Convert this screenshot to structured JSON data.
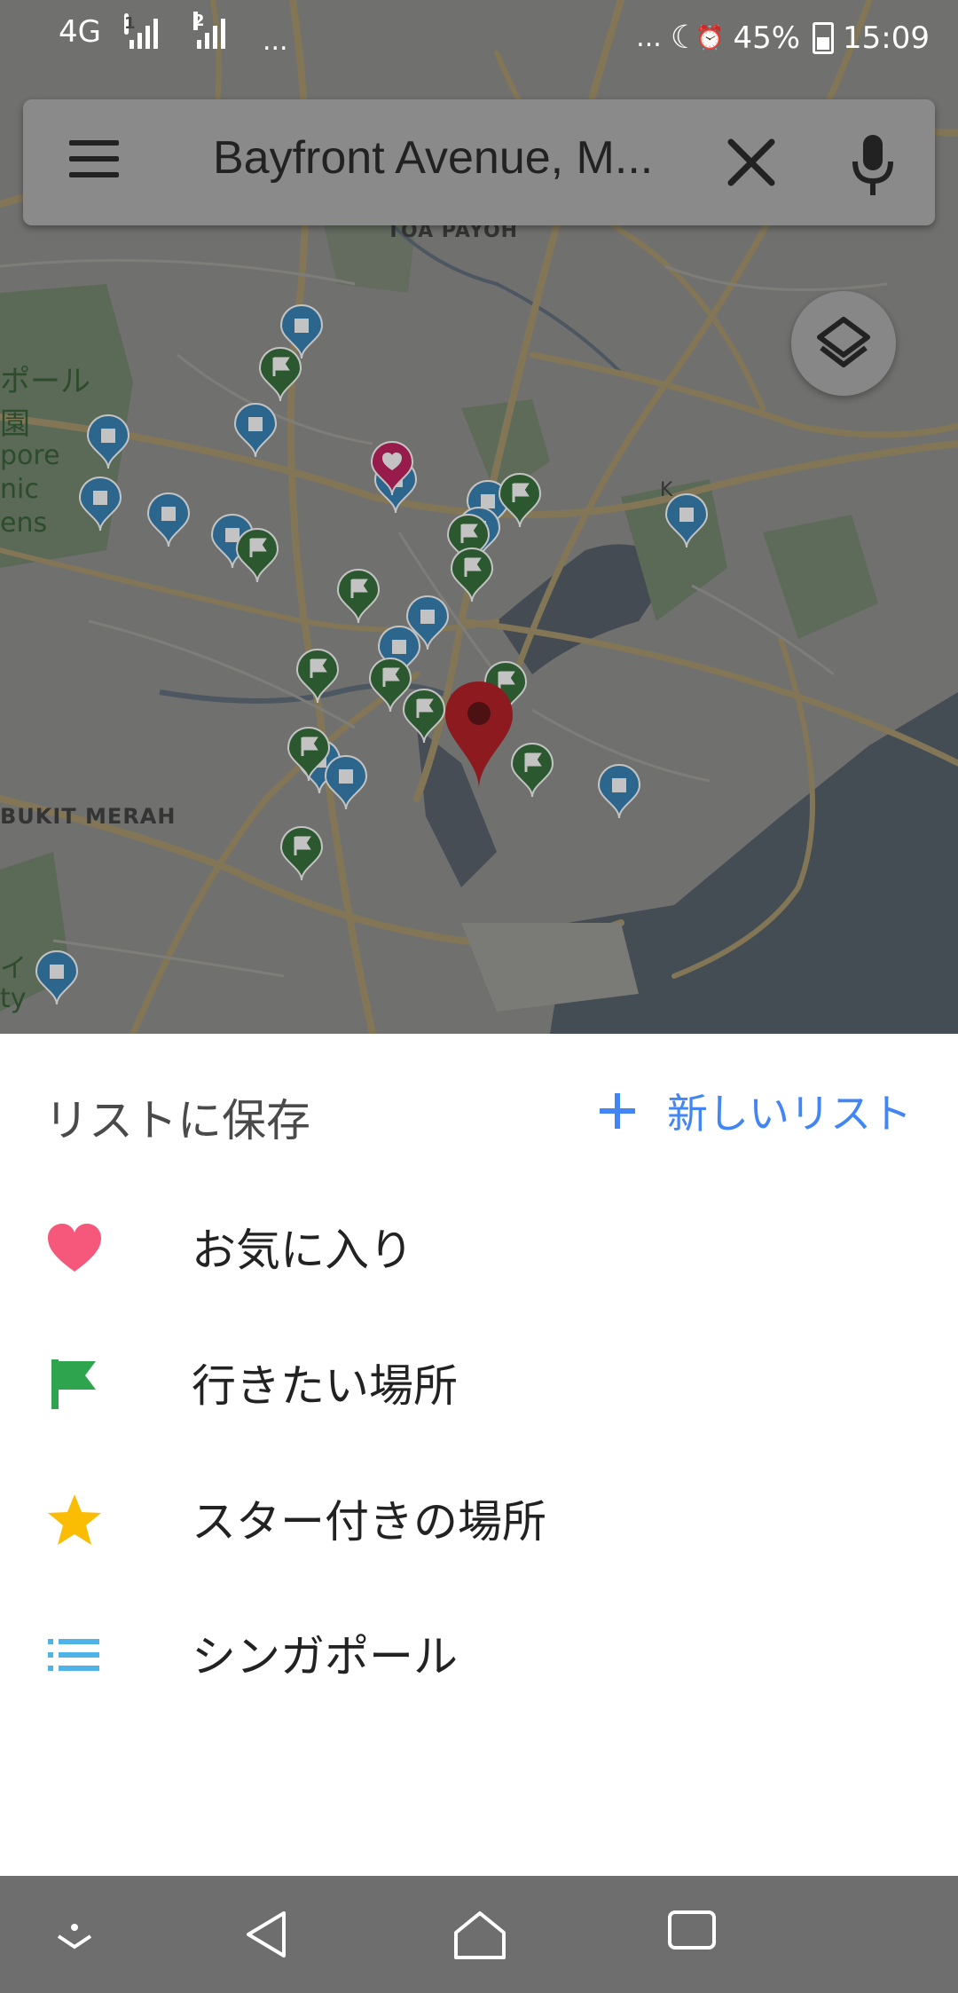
{
  "status_bar": {
    "network": "4G",
    "sim1_badge": "1",
    "sim2_label": "2",
    "more_left": "...",
    "more_right": "...",
    "battery": "45%",
    "time": "15:09"
  },
  "search": {
    "query": "Bayfront Avenue, M...",
    "menu_icon": "menu-icon",
    "clear_icon": "close-icon",
    "voice_icon": "mic-icon"
  },
  "map": {
    "labels": {
      "toa_payoh": "TOA PAYOH",
      "bukit_merah": "BUKIT MERAH",
      "garden_jp_1": "ポール",
      "garden_jp_2": "園",
      "garden_en_1": "pore",
      "garden_en_2": "nic",
      "garden_en_3": "ens",
      "side_jp": "イ",
      "side_en": "ty",
      "small_k": "K"
    },
    "colors": {
      "blue_marker": "#2f7fb5",
      "green_marker": "#2e6b33",
      "red_pin": "#b3161b",
      "pink_marker": "#c2185b"
    }
  },
  "sheet": {
    "title": "リストに保存",
    "new_list_label": "新しいリスト",
    "lists": [
      {
        "label": "お気に入り",
        "icon": "heart-icon",
        "color": "#f5587b"
      },
      {
        "label": "行きたい場所",
        "icon": "flag-icon",
        "color": "#2ea44f"
      },
      {
        "label": "スター付きの場所",
        "icon": "star-icon",
        "color": "#fbbc04"
      },
      {
        "label": "シンガポール",
        "icon": "list-icon",
        "color": "#4fb3e8"
      }
    ]
  },
  "nav": {
    "items": [
      "collapse-icon",
      "back-icon",
      "home-icon",
      "recents-icon"
    ]
  }
}
